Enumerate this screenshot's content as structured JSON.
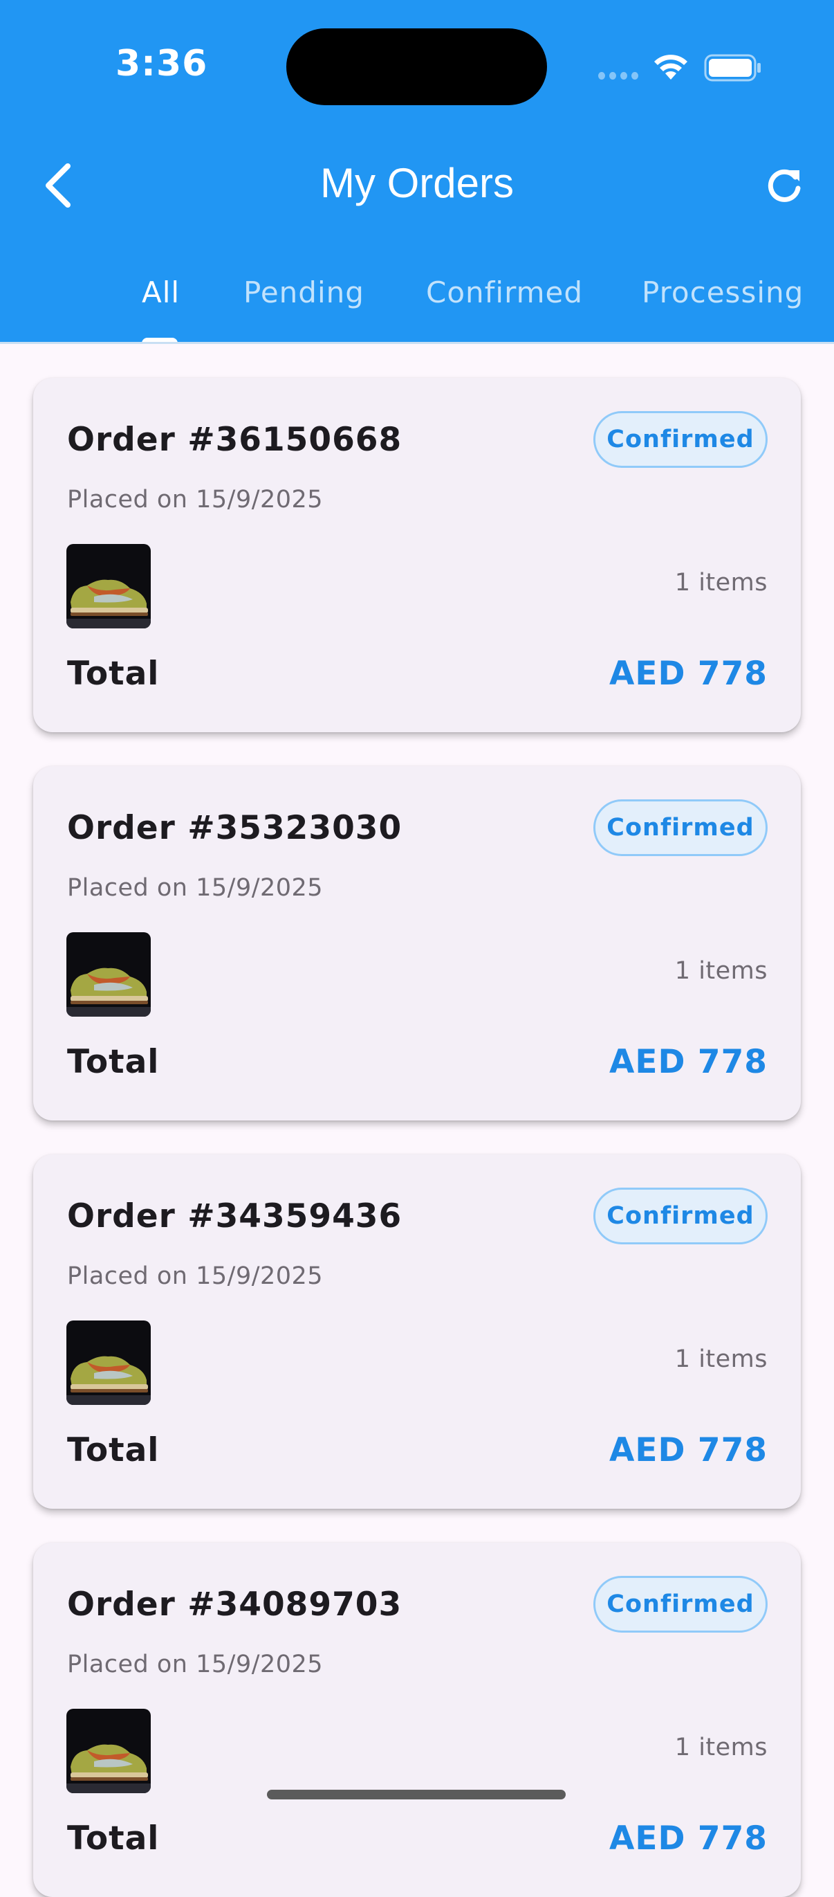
{
  "status_bar": {
    "time": "3:36"
  },
  "header": {
    "title": "My Orders"
  },
  "tabs": [
    {
      "label": "All",
      "active": true
    },
    {
      "label": "Pending",
      "active": false
    },
    {
      "label": "Confirmed",
      "active": false
    },
    {
      "label": "Processing",
      "active": false
    }
  ],
  "orders": [
    {
      "title": "Order #36150668",
      "status": "Confirmed",
      "date": "Placed on 15/9/2025",
      "items": "1 items",
      "total_label": "Total",
      "total": "AED 778"
    },
    {
      "title": "Order #35323030",
      "status": "Confirmed",
      "date": "Placed on 15/9/2025",
      "items": "1 items",
      "total_label": "Total",
      "total": "AED 778"
    },
    {
      "title": "Order #34359436",
      "status": "Confirmed",
      "date": "Placed on 15/9/2025",
      "items": "1 items",
      "total_label": "Total",
      "total": "AED 778"
    },
    {
      "title": "Order #34089703",
      "status": "Confirmed",
      "date": "Placed on 15/9/2025",
      "items": "1 items",
      "total_label": "Total",
      "total": "AED 778"
    }
  ],
  "colors": {
    "primary": "#2196f3",
    "accent_text": "#1e88e5",
    "badge_bg": "#e3effb",
    "badge_border": "#90caf9",
    "card_bg": "#f4eff7",
    "page_bg": "#fdf7fd"
  },
  "icons": [
    "back-arrow-icon",
    "refresh-icon",
    "wifi-icon",
    "battery-icon",
    "cellular-signal-icon"
  ]
}
